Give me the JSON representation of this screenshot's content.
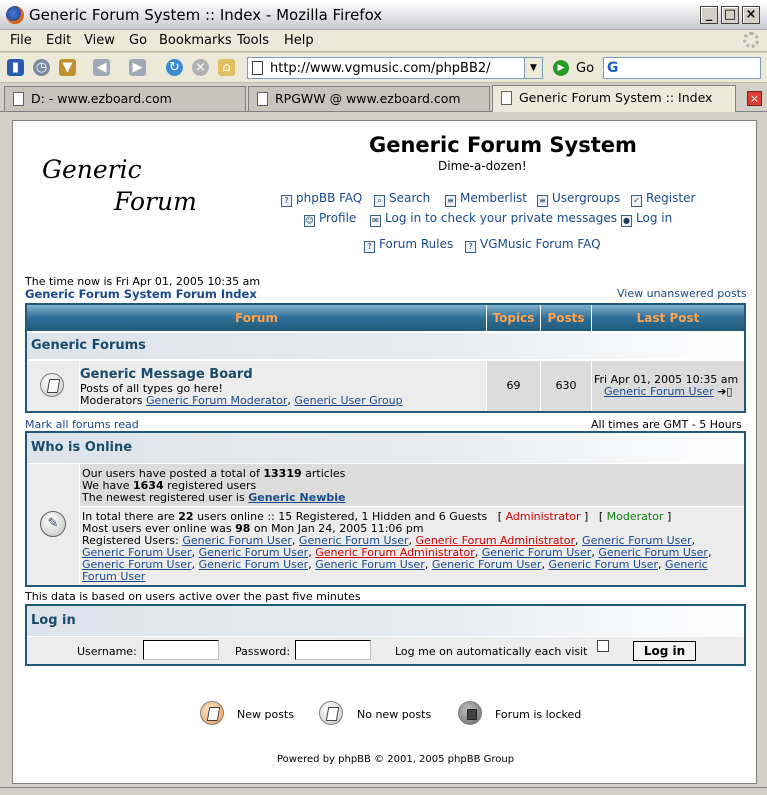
{
  "browser": {
    "window_title": "Generic Forum System :: Index - Mozilla Firefox",
    "menu": [
      "File",
      "Edit",
      "View",
      "Go",
      "Bookmarks",
      "Tools",
      "Help"
    ],
    "url": "http://www.vgmusic.com/phpBB2/",
    "go_label": "Go",
    "tabs": [
      {
        "label": "D: - www.ezboard.com"
      },
      {
        "label": "RPGWW @ www.ezboard.com"
      },
      {
        "label": "Generic Forum System :: Index"
      }
    ]
  },
  "header": {
    "logo_line1": "Generic",
    "logo_line2": "Forum",
    "site_title": "Generic Forum System",
    "site_desc": "Dime-a-dozen!",
    "links": {
      "faq": "phpBB FAQ",
      "search": "Search",
      "memberlist": "Memberlist",
      "usergroups": "Usergroups",
      "register": "Register",
      "profile": "Profile",
      "pm": "Log in to check your private messages",
      "login": "Log in",
      "rules": "Forum Rules",
      "vgm_faq": "VGMusic Forum FAQ"
    }
  },
  "main": {
    "current_time": "The time now is Fri Apr 01, 2005 10:35 am",
    "index_link": "Generic Forum System Forum Index",
    "unanswered": "View unanswered posts",
    "forum_table": {
      "headers": {
        "forum": "Forum",
        "topics": "Topics",
        "posts": "Posts",
        "last_post": "Last Post"
      },
      "category": "Generic Forums",
      "forum": {
        "name": "Generic Message Board",
        "desc": "Posts of all types go here!",
        "moderators_label": "Moderators",
        "moderator1": "Generic Forum Moderator",
        "moderator2": "Generic User Group",
        "topics": "69",
        "posts": "630",
        "last_post_time": "Fri Apr 01, 2005 10:35 am",
        "last_post_user": "Generic Forum User"
      }
    },
    "mark_read": "Mark all forums read",
    "timezone": "All times are GMT - 5 Hours"
  },
  "online": {
    "title": "Who is Online",
    "posted_prefix": "Our users have posted a total of",
    "posted_count": "13319",
    "posted_suffix": "articles",
    "registered_prefix": "We have",
    "registered_count": "1634",
    "registered_suffix": "registered users",
    "newest_prefix": "The newest registered user is",
    "newest_user": "Generic Newbie",
    "total_prefix": "In total there are",
    "total_count": "22",
    "total_suffix": "users online :: 15 Registered, 1 Hidden and 6 Guests",
    "admin_legend": "Administrator",
    "mod_legend": "Moderator",
    "most_prefix": "Most users ever online was",
    "most_count": "98",
    "most_suffix": "on Mon Jan 24, 2005 11:06 pm",
    "registered_users_label": "Registered Users:",
    "users": [
      "Generic Forum User",
      "Generic Forum User",
      "Generic Forum Administrator",
      "Generic Forum User",
      "Generic Forum User",
      "Generic Forum User",
      "Generic Forum Administrator",
      "Generic Forum User",
      "Generic Forum User",
      "Generic Forum User",
      "Generic Forum User",
      "Generic Forum User",
      "Generic Forum User",
      "Generic Forum User",
      "Generic",
      "Forum User"
    ],
    "footnote": "This data is based on users active over the past five minutes"
  },
  "login": {
    "title": "Log in",
    "username_label": "Username:",
    "password_label": "Password:",
    "auto_label": "Log me on automatically each visit",
    "button": "Log in"
  },
  "legend": {
    "new_posts": "New posts",
    "no_new_posts": "No new posts",
    "locked": "Forum is locked"
  },
  "footer": {
    "powered": "Powered by phpBB © 2001, 2005 phpBB Group"
  }
}
